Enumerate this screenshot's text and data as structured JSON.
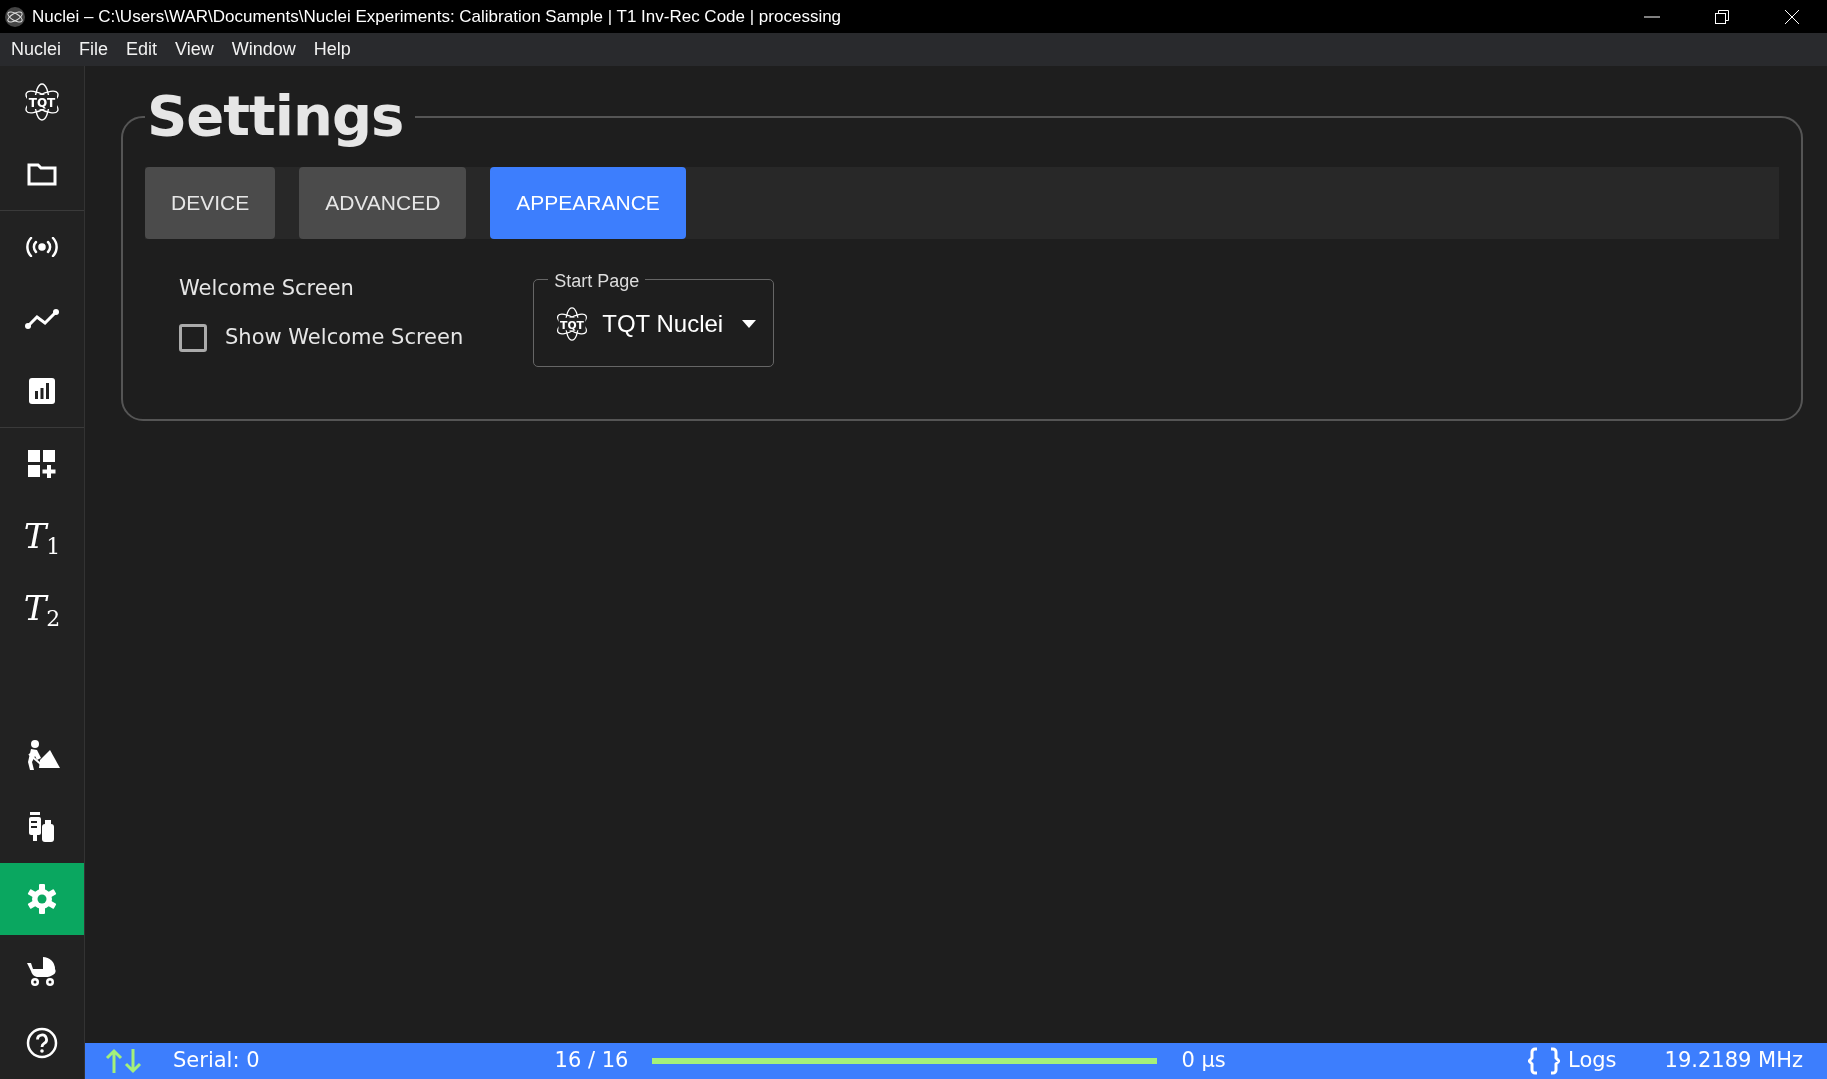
{
  "window": {
    "title": "Nuclei – C:\\Users\\WAR\\Documents\\Nuclei Experiments: Calibration Sample | T1 Inv-Rec Code | processing"
  },
  "menu": [
    "Nuclei",
    "File",
    "Edit",
    "View",
    "Window",
    "Help"
  ],
  "sidebar": {
    "top": [
      {
        "kind": "logo",
        "text": "TQT",
        "selected": false
      },
      {
        "kind": "folder",
        "selected": false
      },
      {
        "kind": "divider"
      },
      {
        "kind": "signal",
        "selected": false
      },
      {
        "kind": "line-chart",
        "selected": false
      },
      {
        "kind": "bar-chart",
        "selected": false
      },
      {
        "kind": "divider"
      },
      {
        "kind": "add-widget",
        "selected": false
      },
      {
        "kind": "text",
        "text": "T$_{1}$",
        "selected": false
      },
      {
        "kind": "text",
        "text": "T$_{2}$",
        "selected": false
      }
    ],
    "bottom": [
      {
        "kind": "worker",
        "selected": false
      },
      {
        "kind": "bottles",
        "selected": false
      },
      {
        "kind": "settings",
        "selected": true
      },
      {
        "kind": "stroller",
        "selected": false
      },
      {
        "kind": "help",
        "selected": false
      }
    ]
  },
  "settings": {
    "title": "Settings",
    "tabs": [
      {
        "label": "DEVICE",
        "selected": false
      },
      {
        "label": "ADVANCED",
        "selected": false
      },
      {
        "label": "APPEARANCE",
        "selected": true
      }
    ],
    "welcome": {
      "heading": "Welcome Screen",
      "checkbox": {
        "label": "Show Welcome Screen",
        "checked": false
      }
    },
    "start_page": {
      "label": "Start Page",
      "logo_text": "TQT",
      "value": "TQT Nuclei"
    }
  },
  "status_bar": {
    "serial": "Serial: 0",
    "count": "16 / 16",
    "level": 1.0,
    "time": "0 µs",
    "logs": "Logs",
    "frequency": "19.2189 MHz"
  }
}
